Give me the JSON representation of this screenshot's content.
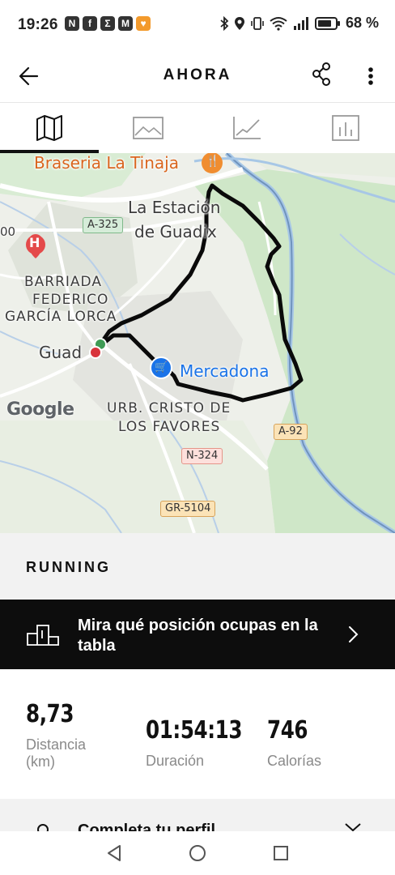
{
  "status_bar": {
    "time": "19:26",
    "app_icons": [
      "N",
      "f",
      "Σ",
      "M",
      "♥"
    ],
    "battery": "68 %"
  },
  "header": {
    "title": "AHORA",
    "back_icon": "arrow-left-icon",
    "share_icon": "share-icon",
    "more_icon": "more-vertical-icon"
  },
  "tabs": [
    {
      "icon": "map-icon",
      "active": true
    },
    {
      "icon": "photo-icon",
      "active": false
    },
    {
      "icon": "line-chart-icon",
      "active": false
    },
    {
      "icon": "bar-chart-icon",
      "active": false
    }
  ],
  "map": {
    "labels": {
      "braseria": "Braseria La Tinaja",
      "estacion_line1": "La Estación",
      "estacion_line2": "de Guadix",
      "barriada_line1": "BARRIADA",
      "barriada_line2": "FEDERICO",
      "barriada_line3": "GARCÍA LORCA",
      "guadix": "Guad",
      "mercadona": "Mercadona",
      "urb_line1": "URB. CRISTO DE",
      "urb_line2": "LOS FAVORES",
      "partial": "00"
    },
    "roads": {
      "a325": "A-325",
      "a92": "A-92",
      "n324": "N-324",
      "gr5104": "GR-5104"
    },
    "attribution": "Google"
  },
  "activity": {
    "type": "RUNNING"
  },
  "leaderboard": {
    "text": "Mira qué posición ocupas en la tabla"
  },
  "stats": {
    "distance": {
      "value": "8,73",
      "label": "Distancia (km)"
    },
    "duration": {
      "value": "01:54:13",
      "label": "Duración"
    },
    "calories": {
      "value": "746",
      "label": "Calorías"
    }
  },
  "profile": {
    "text": "Completa tu perfil"
  }
}
